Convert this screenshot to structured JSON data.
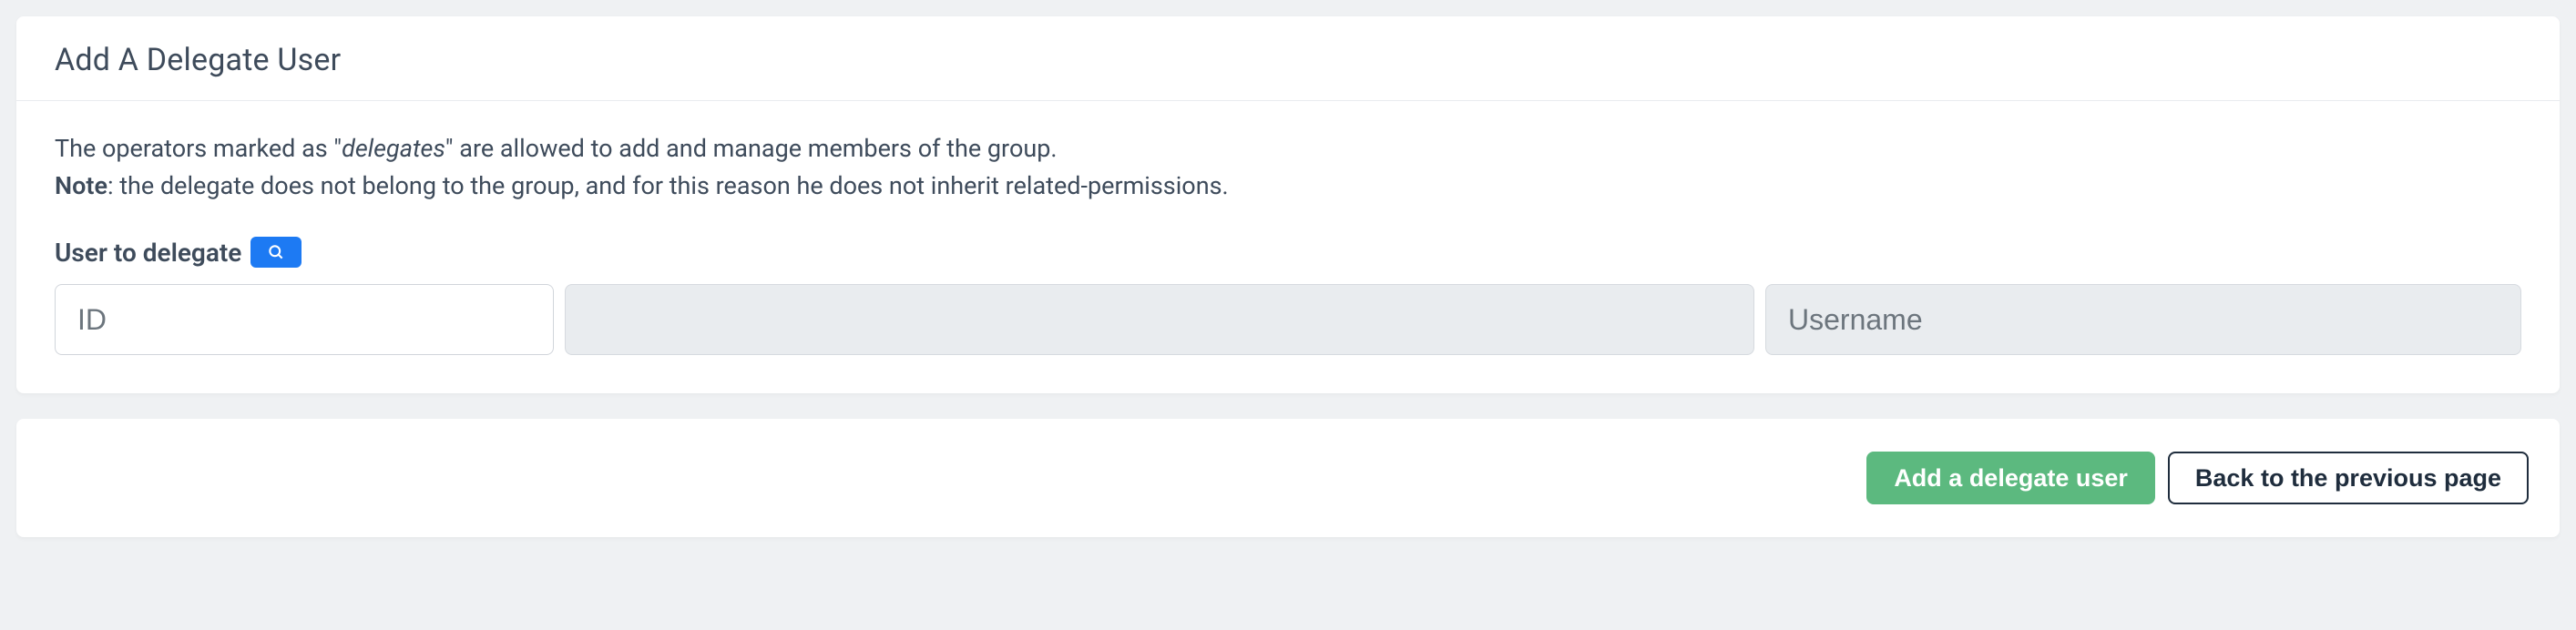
{
  "card": {
    "title": "Add A Delegate User",
    "info_pre": "The operators marked as \"",
    "info_em": "delegates",
    "info_post": "\" are allowed to add and manage members of the group.",
    "note_label": "Note",
    "note_text": ": the delegate does not belong to the group, and for this reason he does not inherit related-permissions.",
    "field_label": "User to delegate",
    "inputs": {
      "id_placeholder": "ID",
      "id_value": "",
      "mid_value": "",
      "username_placeholder": "Username",
      "username_value": ""
    }
  },
  "actions": {
    "primary": "Add a delegate user",
    "secondary": "Back to the previous page"
  }
}
